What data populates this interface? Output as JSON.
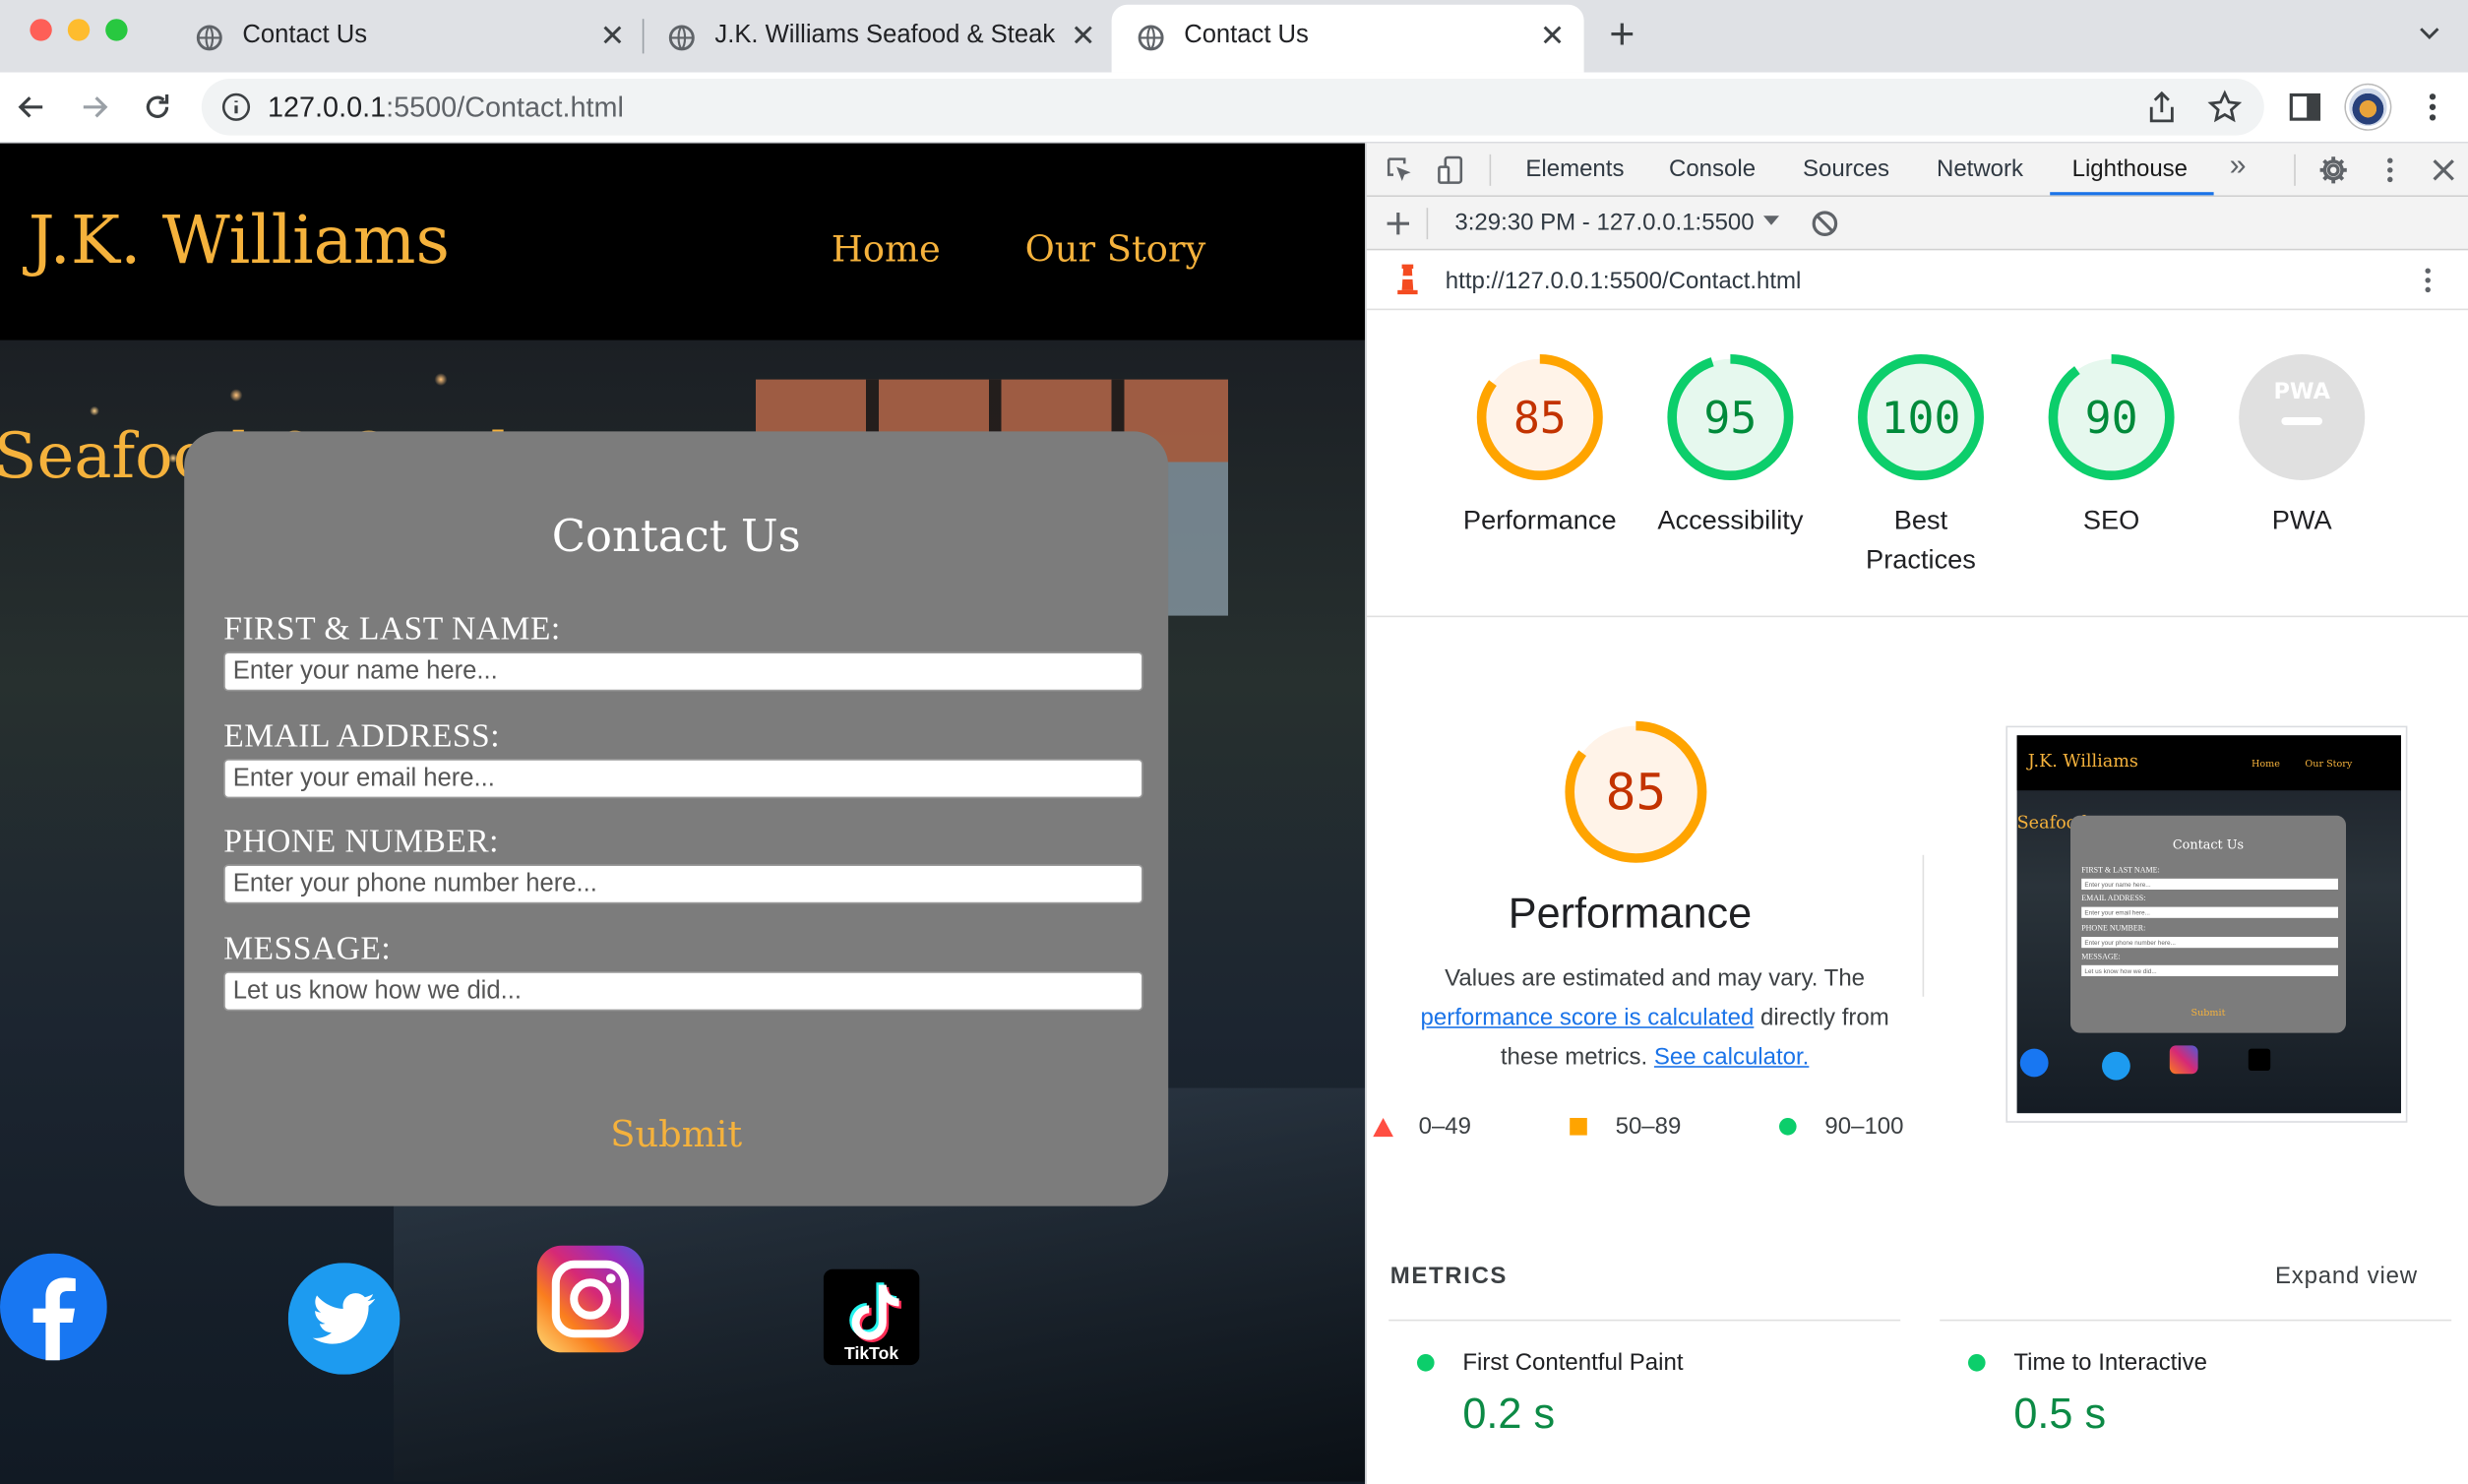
{
  "browser": {
    "tabs": [
      {
        "title": "Contact Us",
        "active": false
      },
      {
        "title": "J.K. Williams Seafood & Steak",
        "active": false
      },
      {
        "title": "Contact Us",
        "active": true
      }
    ],
    "new_tab": "+",
    "close_glyph": "✕",
    "url_host": "127.0.0.1",
    "url_rest": ":5500/Contact.html",
    "icons": [
      "back-icon",
      "forward-icon",
      "reload-icon",
      "info-icon",
      "share-icon",
      "star-icon",
      "sidepanel-icon",
      "kebab-menu-icon"
    ]
  },
  "site": {
    "logo": "J.K. Williams",
    "nav": [
      "Home",
      "Our Story"
    ],
    "tagline": "Seafood & Steak",
    "contact": {
      "title": "Contact Us",
      "fields": [
        {
          "label": "FIRST & LAST NAME:",
          "placeholder": "Enter your name here..."
        },
        {
          "label": "EMAIL ADDRESS:",
          "placeholder": "Enter your email here..."
        },
        {
          "label": "PHONE NUMBER:",
          "placeholder": "Enter your phone number here..."
        },
        {
          "label": "MESSAGE:",
          "placeholder": "Let us know how we did..."
        }
      ],
      "submit": "Submit"
    },
    "social": [
      "facebook-icon",
      "twitter-icon",
      "instagram-icon",
      "tiktok-icon"
    ],
    "tiktok_label": "TikTok"
  },
  "devtools": {
    "tabs": [
      "Elements",
      "Console",
      "Sources",
      "Network",
      "Lighthouse"
    ],
    "active_tab": "Lighthouse",
    "more": "»",
    "report_time": "3:29:30 PM - 127.0.0.1:5500",
    "report_url": "http://127.0.0.1:5500/Contact.html",
    "scores": [
      {
        "value": "85",
        "label": "Performance",
        "color": "#fa3",
        "text_color": "#c33300",
        "fill": "#fff3e8"
      },
      {
        "value": "95",
        "label": "Accessibility",
        "color": "#0cce6b",
        "text_color": "#008a3a",
        "fill": "#e6f8ee"
      },
      {
        "value": "100",
        "label": "Best Practices",
        "color": "#0cce6b",
        "text_color": "#008a3a",
        "fill": "#e6f8ee"
      },
      {
        "value": "90",
        "label": "SEO",
        "color": "#0cce6b",
        "text_color": "#008a3a",
        "fill": "#e6f8ee"
      },
      {
        "value": "PWA",
        "label": "PWA",
        "color": "#ddd",
        "text_color": "#fff",
        "fill": "#e0e0e0"
      }
    ],
    "perf": {
      "score": "85",
      "title": "Performance",
      "desc_1": "Values are estimated and may vary. The",
      "link_1": "performance score is calculated",
      "desc_2": "directly from these metrics.",
      "link_2": "See calculator."
    },
    "legend": [
      {
        "range": "0–49",
        "color": "#ff4e42",
        "shape": "triangle"
      },
      {
        "range": "50–89",
        "color": "#ffa400",
        "shape": "square"
      },
      {
        "range": "90–100",
        "color": "#0cce6b",
        "shape": "circle"
      }
    ],
    "metrics_heading": "METRICS",
    "expand": "Expand view",
    "metrics": [
      {
        "name": "First Contentful Paint",
        "value": "0.2 s"
      },
      {
        "name": "Time to Interactive",
        "value": "0.5 s"
      }
    ],
    "thumb": {
      "logo": "J.K. Williams",
      "nav": [
        "Home",
        "Our Story"
      ],
      "tagline": "Seafood",
      "title": "Contact Us",
      "labels": [
        "FIRST & LAST NAME:",
        "EMAIL ADDRESS:",
        "PHONE NUMBER:",
        "MESSAGE:"
      ],
      "placeholders": [
        "Enter your name here...",
        "Enter your email here...",
        "Enter your phone number here...",
        "Let us know how we did..."
      ],
      "submit": "Submit"
    }
  }
}
